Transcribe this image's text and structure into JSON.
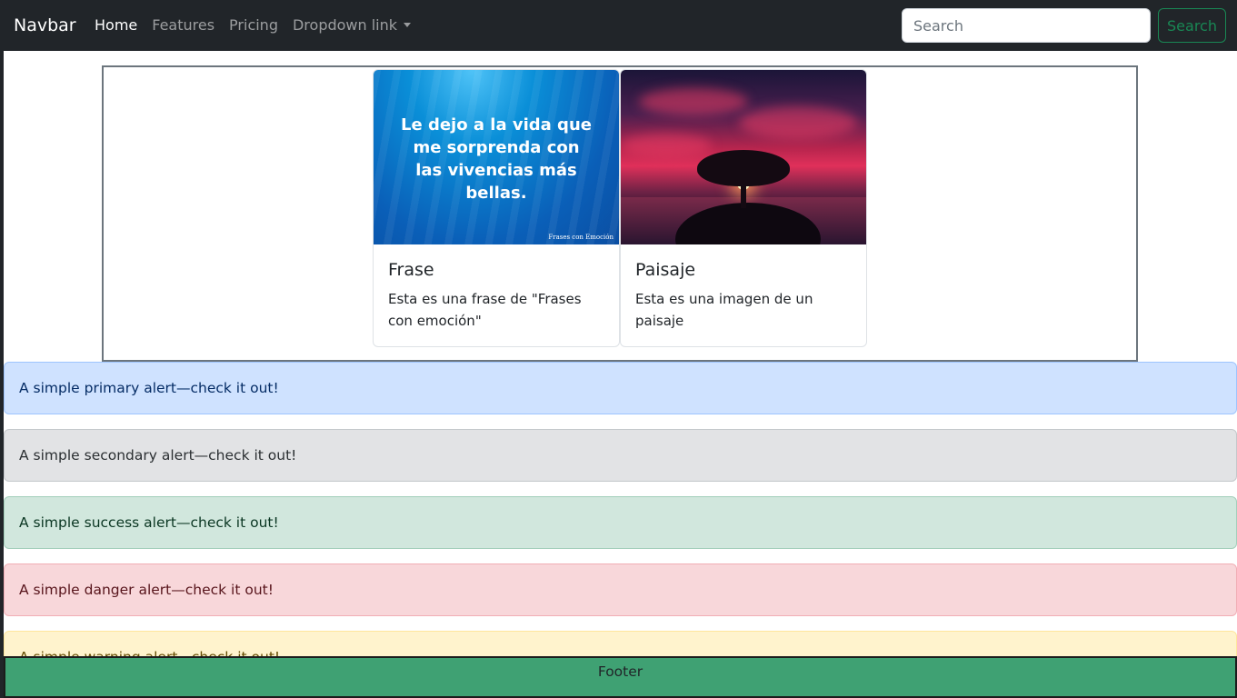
{
  "navbar": {
    "brand": "Navbar",
    "links": [
      {
        "label": "Home",
        "active": true
      },
      {
        "label": "Features",
        "active": false
      },
      {
        "label": "Pricing",
        "active": false
      },
      {
        "label": "Dropdown link",
        "active": false
      }
    ],
    "search_placeholder": "Search",
    "search_button": "Search"
  },
  "cards": [
    {
      "image_text": "Le dejo a la vida que me sorprenda con las vivencias más bellas.",
      "image_watermark": "Frases con Emoción",
      "title": "Frase",
      "text": "Esta es una frase de \"Frases con emoción\""
    },
    {
      "title": "Paisaje",
      "text": "Esta es una imagen de un paisaje"
    }
  ],
  "alerts": {
    "primary": "A simple primary alert—check it out!",
    "secondary": "A simple secondary alert—check it out!",
    "success": "A simple success alert—check it out!",
    "danger": "A simple danger alert—check it out!",
    "warning": "A simple warning alert—check it out!"
  },
  "footer": {
    "text": "Footer"
  },
  "colors": {
    "navbar_bg": "#212529",
    "success": "#198754",
    "footer_bg": "#3fa173"
  }
}
